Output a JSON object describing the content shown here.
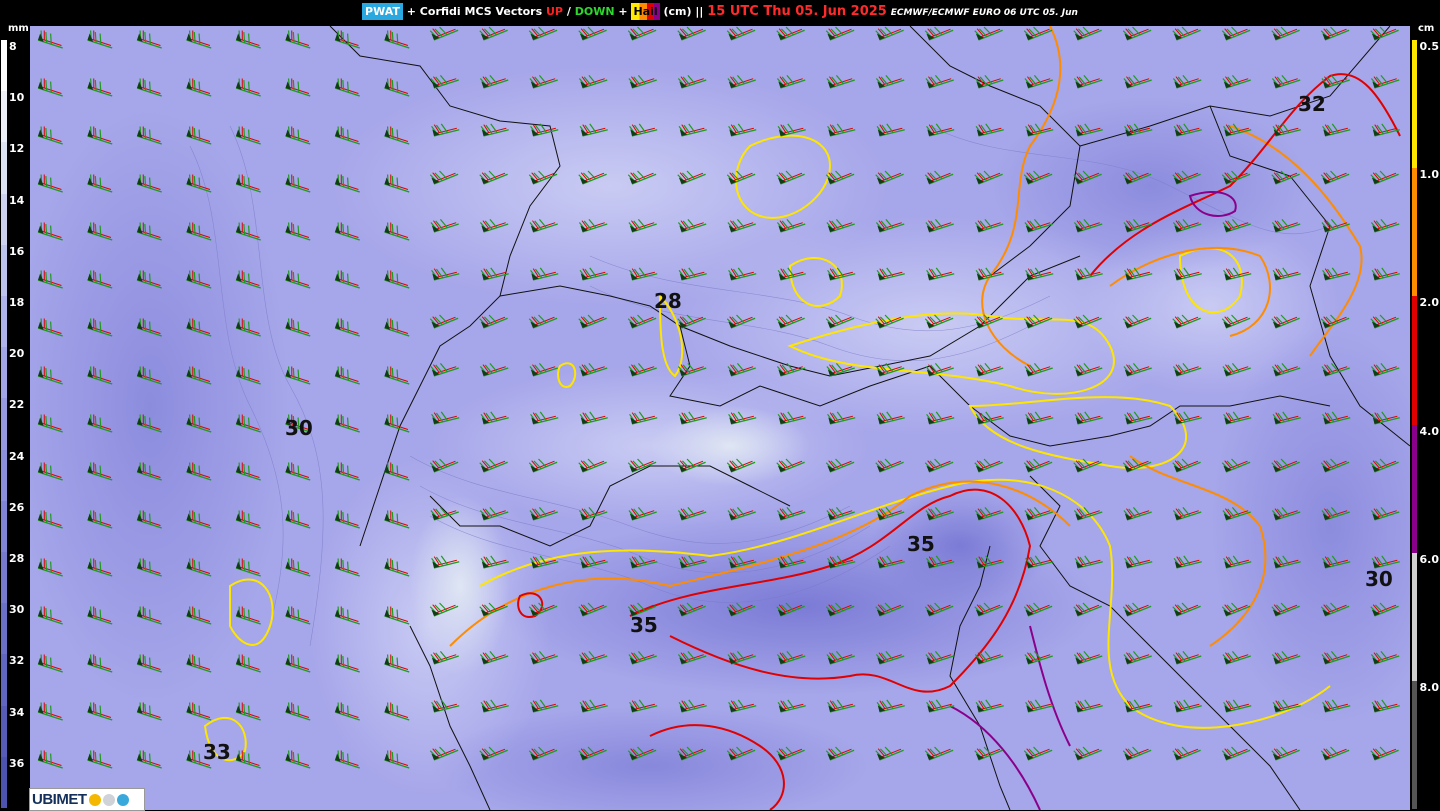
{
  "title": {
    "pwat_label": "PWAT",
    "mid_text": "+ Corfidi MCS Vectors",
    "up_label": "UP",
    "slash": "/",
    "down_label": "DOWN",
    "plus": "+",
    "hail_label": "Hail",
    "hail_unit": "(cm) ||",
    "valid_time": "15 UTC Thu 05. Jun 2025",
    "source": "ECMWF/ECMWF EURO 06 UTC 05. Jun"
  },
  "left_scale": {
    "unit": "mm",
    "ticks": [
      "8",
      "10",
      "12",
      "14",
      "16",
      "18",
      "20",
      "22",
      "24",
      "26",
      "28",
      "30",
      "32",
      "34",
      "36"
    ]
  },
  "right_scale": {
    "unit": "cm",
    "ticks": [
      "0.5",
      "1.0",
      "2.0",
      "4.0",
      "6.0",
      "8.0"
    ],
    "colors": [
      "#ffe600",
      "#ff8c00",
      "#e00000",
      "#8b008b",
      "#d0d0d0",
      "#555555"
    ]
  },
  "map_labels": [
    "28",
    "30",
    "32",
    "35",
    "35",
    "30",
    "33"
  ],
  "colors": {
    "up_vector": "#e00000",
    "down_vector": "#1f9a1f",
    "pwat_base": "#a9a9ee"
  },
  "logo": {
    "text": "UBIMET",
    "icons": [
      "sun-icon",
      "cloud-icon",
      "drop-icon"
    ]
  }
}
